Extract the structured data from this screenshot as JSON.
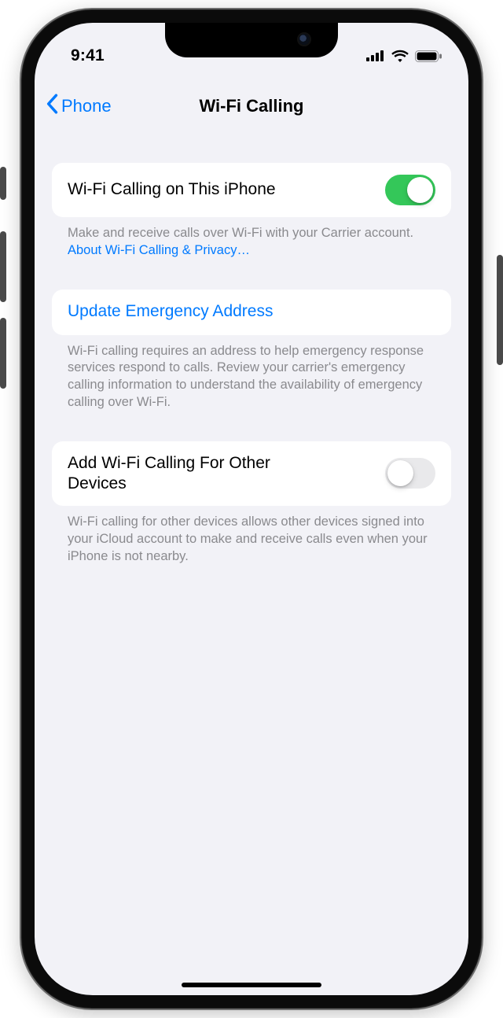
{
  "colors": {
    "accent": "#007aff",
    "switch_on": "#34c759",
    "bg": "#f2f2f7"
  },
  "status": {
    "time": "9:41"
  },
  "nav": {
    "back_label": "Phone",
    "title": "Wi-Fi Calling"
  },
  "groups": {
    "wifiCalling": {
      "label": "Wi-Fi Calling on This iPhone",
      "on": true,
      "footer_text": "Make and receive calls over Wi-Fi with your Carrier account. ",
      "footer_link": "About Wi-Fi Calling & Privacy…"
    },
    "emergency": {
      "label": "Update Emergency Address",
      "footer": "Wi-Fi calling requires an address to help emergency response services respond to calls. Review your carrier's emergency calling information to understand the availability of emergency calling over Wi-Fi."
    },
    "otherDevices": {
      "label": "Add Wi-Fi Calling For Other Devices",
      "on": false,
      "footer": "Wi-Fi calling for other devices allows other devices signed into your iCloud account to make and receive calls even when your iPhone is not nearby."
    }
  }
}
